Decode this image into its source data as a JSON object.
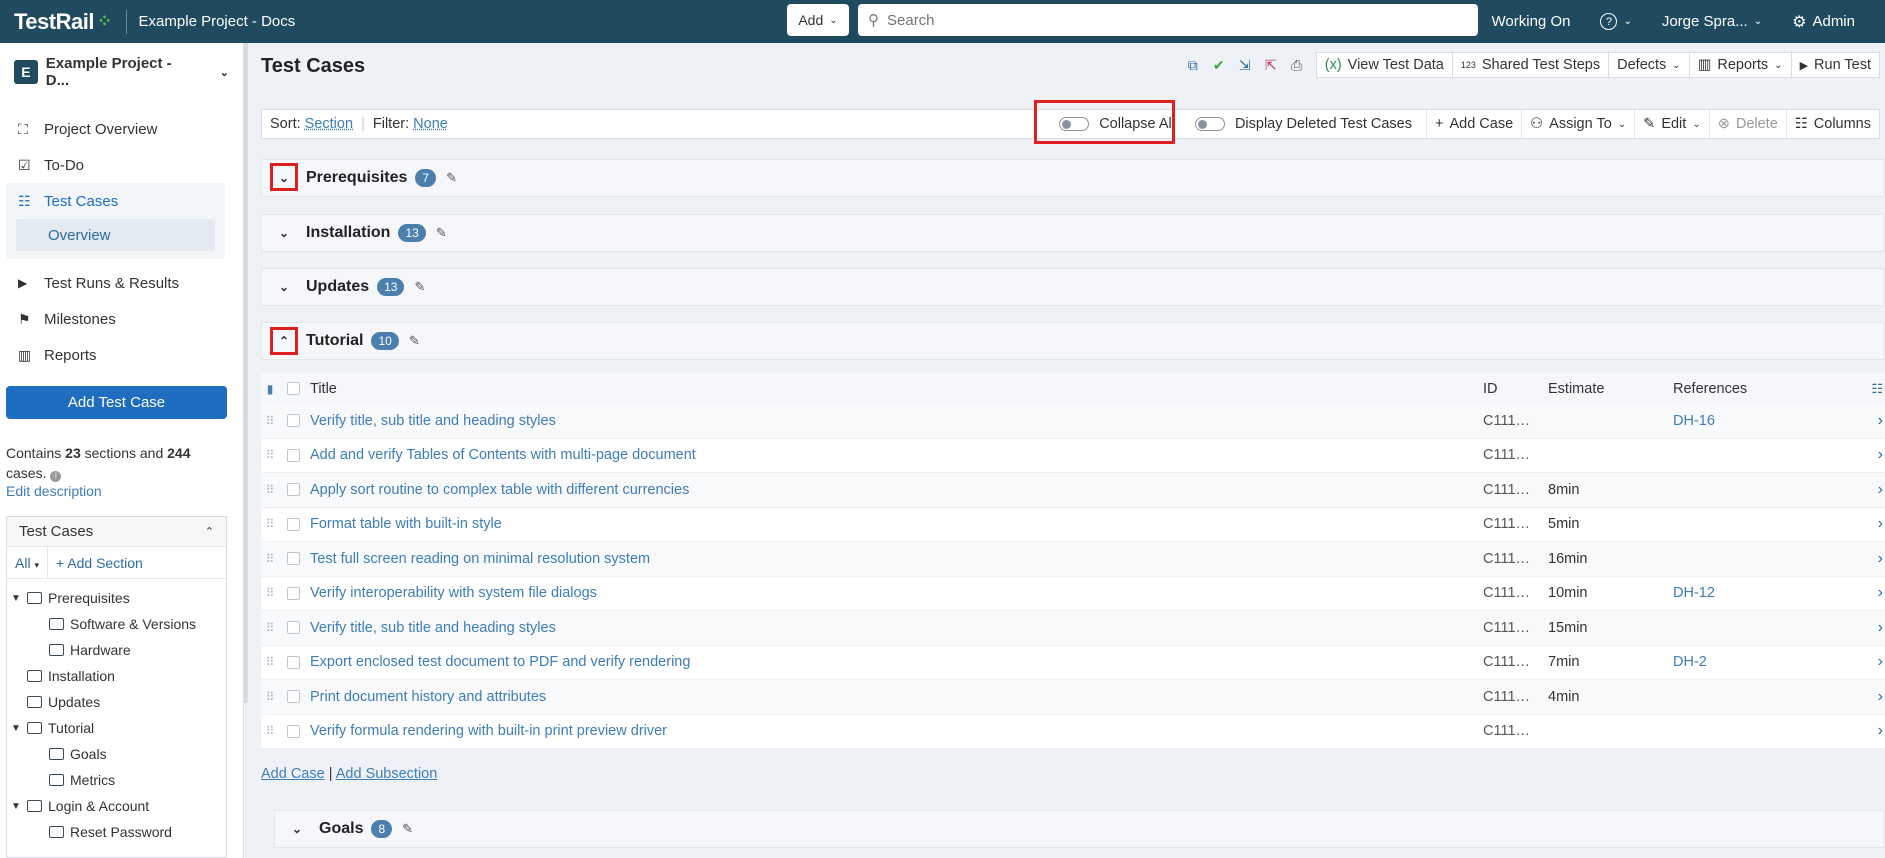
{
  "header": {
    "logo": "TestRail",
    "project": "Example Project - Docs",
    "add_label": "Add",
    "search_placeholder": "Search",
    "working_on": "Working On",
    "user": "Jorge Spra...",
    "admin": "Admin"
  },
  "sidebar": {
    "project_badge": "E",
    "project_name": "Example Project - D...",
    "nav": [
      {
        "label": "Project Overview",
        "icon": "chart-icon"
      },
      {
        "label": "To-Do",
        "icon": "checkbox-icon"
      },
      {
        "label": "Test Cases",
        "icon": "test-cases-icon"
      },
      {
        "label": "Overview"
      },
      {
        "label": "Test Runs & Results",
        "icon": "play-icon"
      },
      {
        "label": "Milestones",
        "icon": "flag-icon"
      },
      {
        "label": "Reports",
        "icon": "bar-chart-icon"
      }
    ],
    "add_test_case": "Add Test Case",
    "contains_prefix": "Contains",
    "sections_count": "23",
    "sections_mid": "sections and",
    "cases_count": "244",
    "cases_suffix": "cases.",
    "edit_description": "Edit description",
    "tree_title": "Test Cases",
    "tree_all": "All",
    "tree_add_section": "+ Add Section",
    "tree": [
      {
        "label": "Prerequisites",
        "level": 0,
        "expanded": true
      },
      {
        "label": "Software & Versions",
        "level": 1
      },
      {
        "label": "Hardware",
        "level": 1
      },
      {
        "label": "Installation",
        "level": 0
      },
      {
        "label": "Updates",
        "level": 0
      },
      {
        "label": "Tutorial",
        "level": 0,
        "expanded": true
      },
      {
        "label": "Goals",
        "level": 1
      },
      {
        "label": "Metrics",
        "level": 1
      },
      {
        "label": "Login & Account",
        "level": 0,
        "expanded": true
      },
      {
        "label": "Reset Password",
        "level": 1
      }
    ]
  },
  "main": {
    "title": "Test Cases",
    "toolbar": {
      "view_test_data": "View Test Data",
      "shared_test_steps": "Shared Test Steps",
      "defects": "Defects",
      "reports": "Reports",
      "run_test": "Run Test"
    },
    "filterbar": {
      "sort_label": "Sort:",
      "sort_value": "Section",
      "filter_label": "Filter:",
      "filter_value": "None",
      "collapse_all": "Collapse All",
      "display_deleted": "Display Deleted Test Cases",
      "add_case": "Add Case",
      "assign_to": "Assign To",
      "edit": "Edit",
      "delete": "Delete",
      "columns": "Columns"
    },
    "sections": [
      {
        "name": "Prerequisites",
        "count": "7"
      },
      {
        "name": "Installation",
        "count": "13"
      },
      {
        "name": "Updates",
        "count": "13"
      },
      {
        "name": "Tutorial",
        "count": "10"
      },
      {
        "name": "Goals",
        "count": "8"
      }
    ],
    "table": {
      "headers": {
        "title": "Title",
        "id": "ID",
        "estimate": "Estimate",
        "references": "References"
      },
      "rows": [
        {
          "title": "Verify title, sub title and heading styles",
          "id": "C111…",
          "estimate": "",
          "ref": "DH-16"
        },
        {
          "title": "Add and verify Tables of Contents with multi-page document",
          "id": "C111…",
          "estimate": "",
          "ref": ""
        },
        {
          "title": "Apply sort routine to complex table with different currencies",
          "id": "C111…",
          "estimate": "8min",
          "ref": ""
        },
        {
          "title": "Format table with built-in style",
          "id": "C111…",
          "estimate": "5min",
          "ref": ""
        },
        {
          "title": "Test full screen reading on minimal resolution system",
          "id": "C111…",
          "estimate": "16min",
          "ref": ""
        },
        {
          "title": "Verify interoperability with system file dialogs",
          "id": "C111…",
          "estimate": "10min",
          "ref": "DH-12"
        },
        {
          "title": "Verify title, sub title and heading styles",
          "id": "C111…",
          "estimate": "15min",
          "ref": ""
        },
        {
          "title": "Export enclosed test document to PDF and verify rendering",
          "id": "C111…",
          "estimate": "7min",
          "ref": "DH-2"
        },
        {
          "title": "Print document history and attributes",
          "id": "C111…",
          "estimate": "4min",
          "ref": ""
        },
        {
          "title": "Verify formula rendering with built-in print preview driver",
          "id": "C111…",
          "estimate": "",
          "ref": ""
        }
      ]
    },
    "add_case_link": "Add Case",
    "add_subsection_link": "Add Subsection",
    "separator": "|"
  },
  "colors": {
    "topbar": "#1f4a5f",
    "primary": "#1f6dc1",
    "link": "#3d7db8",
    "highlight": "#e02020",
    "badge": "#4c7fae"
  }
}
